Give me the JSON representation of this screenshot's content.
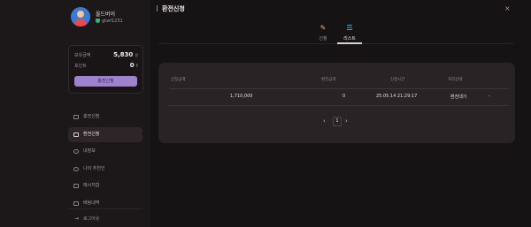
{
  "profile": {
    "name": "올드버이",
    "user_id": "gtwf1231"
  },
  "balance": {
    "holding_label": "보유금액",
    "holding_value": "5,830",
    "holding_unit": "원",
    "points_label": "포인트",
    "points_value": "0",
    "points_unit": "P",
    "charge_button": "충전신청"
  },
  "sidebar": {
    "items": [
      {
        "label": "충전신청",
        "icon": "card-icon"
      },
      {
        "label": "환전신청",
        "icon": "wallet-icon",
        "active": true
      },
      {
        "label": "내정보",
        "icon": "user-icon"
      },
      {
        "label": "나의 추천인",
        "icon": "users-icon"
      },
      {
        "label": "메시지함",
        "icon": "message-icon"
      },
      {
        "label": "베팅내역",
        "icon": "list-icon"
      }
    ],
    "logout": "로그아웃"
  },
  "page": {
    "title": "환전신청",
    "close": "×"
  },
  "tabs": [
    {
      "label": "신청",
      "icon": "pencil-icon"
    },
    {
      "label": "리스트",
      "icon": "list-icon",
      "active": true
    }
  ],
  "table": {
    "headers": [
      "신청금액",
      "환전금액",
      "신청시간",
      "처리상태"
    ],
    "rows": [
      {
        "request_amount": "1,710,000",
        "exchange_amount": "0",
        "time": "25.05.14 21:29:17",
        "status": "환전대기",
        "extra": "-"
      }
    ]
  },
  "pagination": {
    "prev": "‹",
    "current": "1",
    "next": "›"
  }
}
